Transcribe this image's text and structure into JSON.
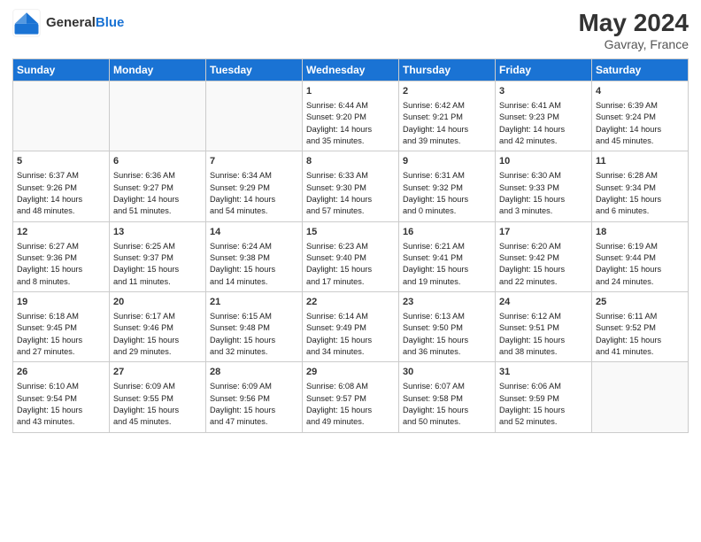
{
  "header": {
    "logo_general": "General",
    "logo_blue": "Blue",
    "month_year": "May 2024",
    "location": "Gavray, France"
  },
  "weekdays": [
    "Sunday",
    "Monday",
    "Tuesday",
    "Wednesday",
    "Thursday",
    "Friday",
    "Saturday"
  ],
  "weeks": [
    [
      {
        "day": "",
        "info": ""
      },
      {
        "day": "",
        "info": ""
      },
      {
        "day": "",
        "info": ""
      },
      {
        "day": "1",
        "info": "Sunrise: 6:44 AM\nSunset: 9:20 PM\nDaylight: 14 hours\nand 35 minutes."
      },
      {
        "day": "2",
        "info": "Sunrise: 6:42 AM\nSunset: 9:21 PM\nDaylight: 14 hours\nand 39 minutes."
      },
      {
        "day": "3",
        "info": "Sunrise: 6:41 AM\nSunset: 9:23 PM\nDaylight: 14 hours\nand 42 minutes."
      },
      {
        "day": "4",
        "info": "Sunrise: 6:39 AM\nSunset: 9:24 PM\nDaylight: 14 hours\nand 45 minutes."
      }
    ],
    [
      {
        "day": "5",
        "info": "Sunrise: 6:37 AM\nSunset: 9:26 PM\nDaylight: 14 hours\nand 48 minutes."
      },
      {
        "day": "6",
        "info": "Sunrise: 6:36 AM\nSunset: 9:27 PM\nDaylight: 14 hours\nand 51 minutes."
      },
      {
        "day": "7",
        "info": "Sunrise: 6:34 AM\nSunset: 9:29 PM\nDaylight: 14 hours\nand 54 minutes."
      },
      {
        "day": "8",
        "info": "Sunrise: 6:33 AM\nSunset: 9:30 PM\nDaylight: 14 hours\nand 57 minutes."
      },
      {
        "day": "9",
        "info": "Sunrise: 6:31 AM\nSunset: 9:32 PM\nDaylight: 15 hours\nand 0 minutes."
      },
      {
        "day": "10",
        "info": "Sunrise: 6:30 AM\nSunset: 9:33 PM\nDaylight: 15 hours\nand 3 minutes."
      },
      {
        "day": "11",
        "info": "Sunrise: 6:28 AM\nSunset: 9:34 PM\nDaylight: 15 hours\nand 6 minutes."
      }
    ],
    [
      {
        "day": "12",
        "info": "Sunrise: 6:27 AM\nSunset: 9:36 PM\nDaylight: 15 hours\nand 8 minutes."
      },
      {
        "day": "13",
        "info": "Sunrise: 6:25 AM\nSunset: 9:37 PM\nDaylight: 15 hours\nand 11 minutes."
      },
      {
        "day": "14",
        "info": "Sunrise: 6:24 AM\nSunset: 9:38 PM\nDaylight: 15 hours\nand 14 minutes."
      },
      {
        "day": "15",
        "info": "Sunrise: 6:23 AM\nSunset: 9:40 PM\nDaylight: 15 hours\nand 17 minutes."
      },
      {
        "day": "16",
        "info": "Sunrise: 6:21 AM\nSunset: 9:41 PM\nDaylight: 15 hours\nand 19 minutes."
      },
      {
        "day": "17",
        "info": "Sunrise: 6:20 AM\nSunset: 9:42 PM\nDaylight: 15 hours\nand 22 minutes."
      },
      {
        "day": "18",
        "info": "Sunrise: 6:19 AM\nSunset: 9:44 PM\nDaylight: 15 hours\nand 24 minutes."
      }
    ],
    [
      {
        "day": "19",
        "info": "Sunrise: 6:18 AM\nSunset: 9:45 PM\nDaylight: 15 hours\nand 27 minutes."
      },
      {
        "day": "20",
        "info": "Sunrise: 6:17 AM\nSunset: 9:46 PM\nDaylight: 15 hours\nand 29 minutes."
      },
      {
        "day": "21",
        "info": "Sunrise: 6:15 AM\nSunset: 9:48 PM\nDaylight: 15 hours\nand 32 minutes."
      },
      {
        "day": "22",
        "info": "Sunrise: 6:14 AM\nSunset: 9:49 PM\nDaylight: 15 hours\nand 34 minutes."
      },
      {
        "day": "23",
        "info": "Sunrise: 6:13 AM\nSunset: 9:50 PM\nDaylight: 15 hours\nand 36 minutes."
      },
      {
        "day": "24",
        "info": "Sunrise: 6:12 AM\nSunset: 9:51 PM\nDaylight: 15 hours\nand 38 minutes."
      },
      {
        "day": "25",
        "info": "Sunrise: 6:11 AM\nSunset: 9:52 PM\nDaylight: 15 hours\nand 41 minutes."
      }
    ],
    [
      {
        "day": "26",
        "info": "Sunrise: 6:10 AM\nSunset: 9:54 PM\nDaylight: 15 hours\nand 43 minutes."
      },
      {
        "day": "27",
        "info": "Sunrise: 6:09 AM\nSunset: 9:55 PM\nDaylight: 15 hours\nand 45 minutes."
      },
      {
        "day": "28",
        "info": "Sunrise: 6:09 AM\nSunset: 9:56 PM\nDaylight: 15 hours\nand 47 minutes."
      },
      {
        "day": "29",
        "info": "Sunrise: 6:08 AM\nSunset: 9:57 PM\nDaylight: 15 hours\nand 49 minutes."
      },
      {
        "day": "30",
        "info": "Sunrise: 6:07 AM\nSunset: 9:58 PM\nDaylight: 15 hours\nand 50 minutes."
      },
      {
        "day": "31",
        "info": "Sunrise: 6:06 AM\nSunset: 9:59 PM\nDaylight: 15 hours\nand 52 minutes."
      },
      {
        "day": "",
        "info": ""
      }
    ]
  ]
}
